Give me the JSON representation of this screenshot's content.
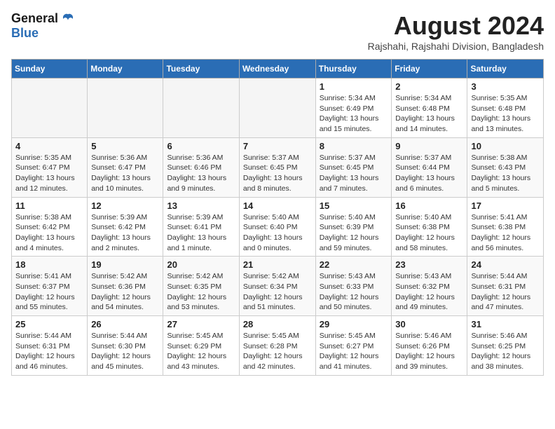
{
  "logo": {
    "general": "General",
    "blue": "Blue"
  },
  "title": "August 2024",
  "location": "Rajshahi, Rajshahi Division, Bangladesh",
  "weekdays": [
    "Sunday",
    "Monday",
    "Tuesday",
    "Wednesday",
    "Thursday",
    "Friday",
    "Saturday"
  ],
  "weeks": [
    [
      {
        "day": "",
        "info": ""
      },
      {
        "day": "",
        "info": ""
      },
      {
        "day": "",
        "info": ""
      },
      {
        "day": "",
        "info": ""
      },
      {
        "day": "1",
        "info": "Sunrise: 5:34 AM\nSunset: 6:49 PM\nDaylight: 13 hours\nand 15 minutes."
      },
      {
        "day": "2",
        "info": "Sunrise: 5:34 AM\nSunset: 6:48 PM\nDaylight: 13 hours\nand 14 minutes."
      },
      {
        "day": "3",
        "info": "Sunrise: 5:35 AM\nSunset: 6:48 PM\nDaylight: 13 hours\nand 13 minutes."
      }
    ],
    [
      {
        "day": "4",
        "info": "Sunrise: 5:35 AM\nSunset: 6:47 PM\nDaylight: 13 hours\nand 12 minutes."
      },
      {
        "day": "5",
        "info": "Sunrise: 5:36 AM\nSunset: 6:47 PM\nDaylight: 13 hours\nand 10 minutes."
      },
      {
        "day": "6",
        "info": "Sunrise: 5:36 AM\nSunset: 6:46 PM\nDaylight: 13 hours\nand 9 minutes."
      },
      {
        "day": "7",
        "info": "Sunrise: 5:37 AM\nSunset: 6:45 PM\nDaylight: 13 hours\nand 8 minutes."
      },
      {
        "day": "8",
        "info": "Sunrise: 5:37 AM\nSunset: 6:45 PM\nDaylight: 13 hours\nand 7 minutes."
      },
      {
        "day": "9",
        "info": "Sunrise: 5:37 AM\nSunset: 6:44 PM\nDaylight: 13 hours\nand 6 minutes."
      },
      {
        "day": "10",
        "info": "Sunrise: 5:38 AM\nSunset: 6:43 PM\nDaylight: 13 hours\nand 5 minutes."
      }
    ],
    [
      {
        "day": "11",
        "info": "Sunrise: 5:38 AM\nSunset: 6:42 PM\nDaylight: 13 hours\nand 4 minutes."
      },
      {
        "day": "12",
        "info": "Sunrise: 5:39 AM\nSunset: 6:42 PM\nDaylight: 13 hours\nand 2 minutes."
      },
      {
        "day": "13",
        "info": "Sunrise: 5:39 AM\nSunset: 6:41 PM\nDaylight: 13 hours\nand 1 minute."
      },
      {
        "day": "14",
        "info": "Sunrise: 5:40 AM\nSunset: 6:40 PM\nDaylight: 13 hours\nand 0 minutes."
      },
      {
        "day": "15",
        "info": "Sunrise: 5:40 AM\nSunset: 6:39 PM\nDaylight: 12 hours\nand 59 minutes."
      },
      {
        "day": "16",
        "info": "Sunrise: 5:40 AM\nSunset: 6:38 PM\nDaylight: 12 hours\nand 58 minutes."
      },
      {
        "day": "17",
        "info": "Sunrise: 5:41 AM\nSunset: 6:38 PM\nDaylight: 12 hours\nand 56 minutes."
      }
    ],
    [
      {
        "day": "18",
        "info": "Sunrise: 5:41 AM\nSunset: 6:37 PM\nDaylight: 12 hours\nand 55 minutes."
      },
      {
        "day": "19",
        "info": "Sunrise: 5:42 AM\nSunset: 6:36 PM\nDaylight: 12 hours\nand 54 minutes."
      },
      {
        "day": "20",
        "info": "Sunrise: 5:42 AM\nSunset: 6:35 PM\nDaylight: 12 hours\nand 53 minutes."
      },
      {
        "day": "21",
        "info": "Sunrise: 5:42 AM\nSunset: 6:34 PM\nDaylight: 12 hours\nand 51 minutes."
      },
      {
        "day": "22",
        "info": "Sunrise: 5:43 AM\nSunset: 6:33 PM\nDaylight: 12 hours\nand 50 minutes."
      },
      {
        "day": "23",
        "info": "Sunrise: 5:43 AM\nSunset: 6:32 PM\nDaylight: 12 hours\nand 49 minutes."
      },
      {
        "day": "24",
        "info": "Sunrise: 5:44 AM\nSunset: 6:31 PM\nDaylight: 12 hours\nand 47 minutes."
      }
    ],
    [
      {
        "day": "25",
        "info": "Sunrise: 5:44 AM\nSunset: 6:31 PM\nDaylight: 12 hours\nand 46 minutes."
      },
      {
        "day": "26",
        "info": "Sunrise: 5:44 AM\nSunset: 6:30 PM\nDaylight: 12 hours\nand 45 minutes."
      },
      {
        "day": "27",
        "info": "Sunrise: 5:45 AM\nSunset: 6:29 PM\nDaylight: 12 hours\nand 43 minutes."
      },
      {
        "day": "28",
        "info": "Sunrise: 5:45 AM\nSunset: 6:28 PM\nDaylight: 12 hours\nand 42 minutes."
      },
      {
        "day": "29",
        "info": "Sunrise: 5:45 AM\nSunset: 6:27 PM\nDaylight: 12 hours\nand 41 minutes."
      },
      {
        "day": "30",
        "info": "Sunrise: 5:46 AM\nSunset: 6:26 PM\nDaylight: 12 hours\nand 39 minutes."
      },
      {
        "day": "31",
        "info": "Sunrise: 5:46 AM\nSunset: 6:25 PM\nDaylight: 12 hours\nand 38 minutes."
      }
    ]
  ]
}
